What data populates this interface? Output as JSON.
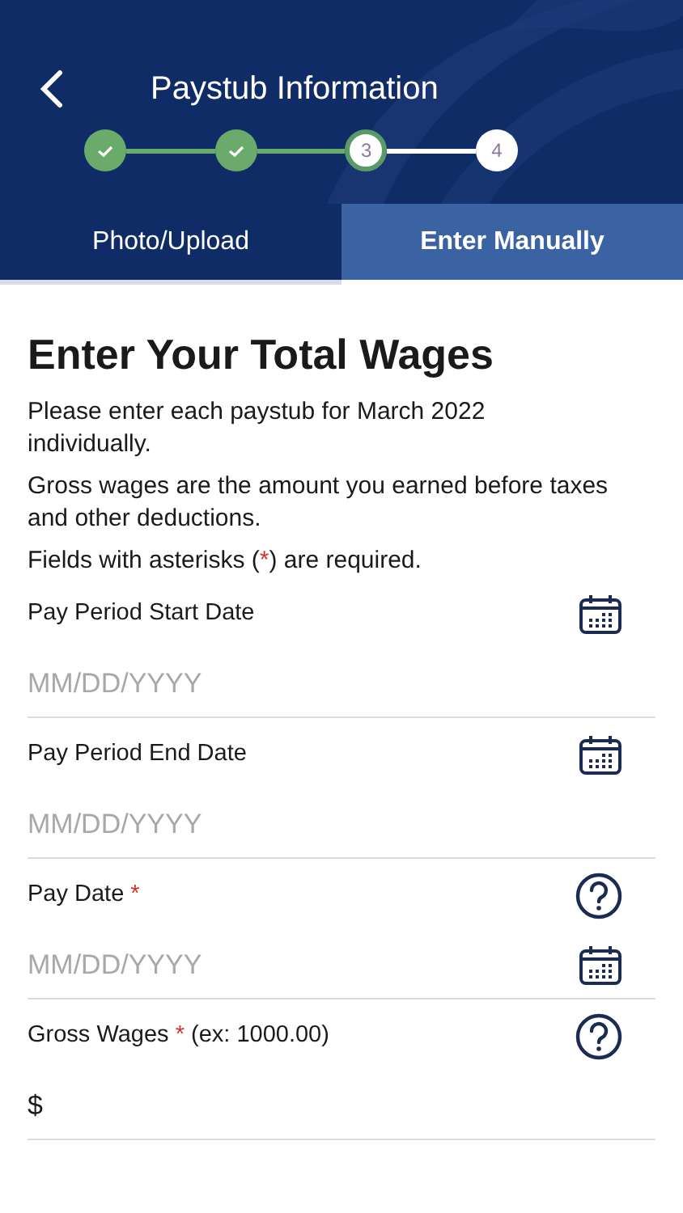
{
  "header": {
    "title": "Paystub Information"
  },
  "steps": [
    {
      "kind": "done"
    },
    {
      "kind": "done"
    },
    {
      "kind": "current",
      "label": "3"
    },
    {
      "kind": "pending",
      "label": "4"
    }
  ],
  "tabs": [
    {
      "label": "Photo/Upload",
      "selected": false
    },
    {
      "label": "Enter Manually",
      "selected": true
    }
  ],
  "heading": "Enter Your Total Wages",
  "paragraphs": [
    "Please enter each paystub for March 2022 individually.",
    "Gross wages are the amount you earned before taxes and other deductions."
  ],
  "required_note": {
    "before": "Fields with asterisks (",
    "mark": "*",
    "after": ") are required."
  },
  "fields": [
    {
      "label": "Pay Period Start Date",
      "required": false,
      "label_icon": {
        "kind": "calendar"
      },
      "placeholder": "MM/DD/YYYY"
    },
    {
      "label": "Pay Period End Date",
      "required": false,
      "label_icon": {
        "kind": "calendar"
      },
      "placeholder": "MM/DD/YYYY"
    },
    {
      "label": "Pay Date",
      "required": true,
      "label_icon": {
        "kind": "help"
      },
      "input_icon": {
        "kind": "calendar"
      },
      "placeholder": "MM/DD/YYYY"
    },
    {
      "label": "Gross Wages",
      "required": true,
      "hint": "(ex: 1000.00)",
      "label_icon": {
        "kind": "help"
      },
      "prefix": "$"
    }
  ]
}
